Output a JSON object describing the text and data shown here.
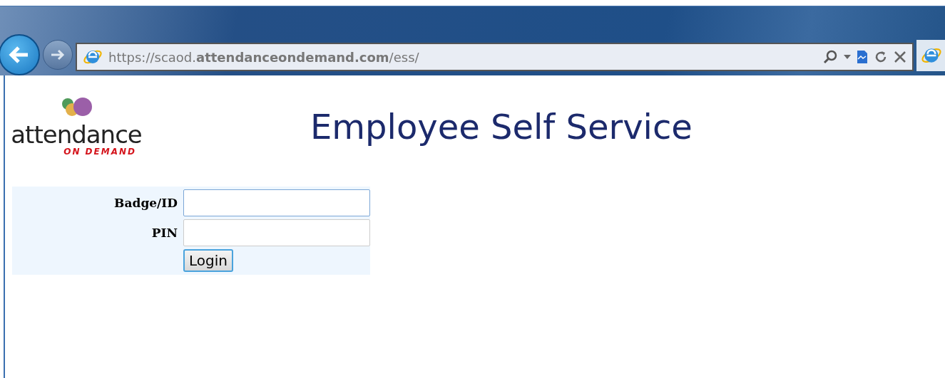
{
  "browser": {
    "address": "https://scaod.**attendanceondemand.com**/ess/"
  },
  "logo": {
    "word": "attendance",
    "tagline": "ON DEMAND"
  },
  "page_title": "Employee Self Service",
  "form": {
    "fields": [
      {
        "label": "Badge/ID",
        "focused": true
      },
      {
        "label": "PIN",
        "focused": false
      }
    ],
    "button": "Login"
  }
}
